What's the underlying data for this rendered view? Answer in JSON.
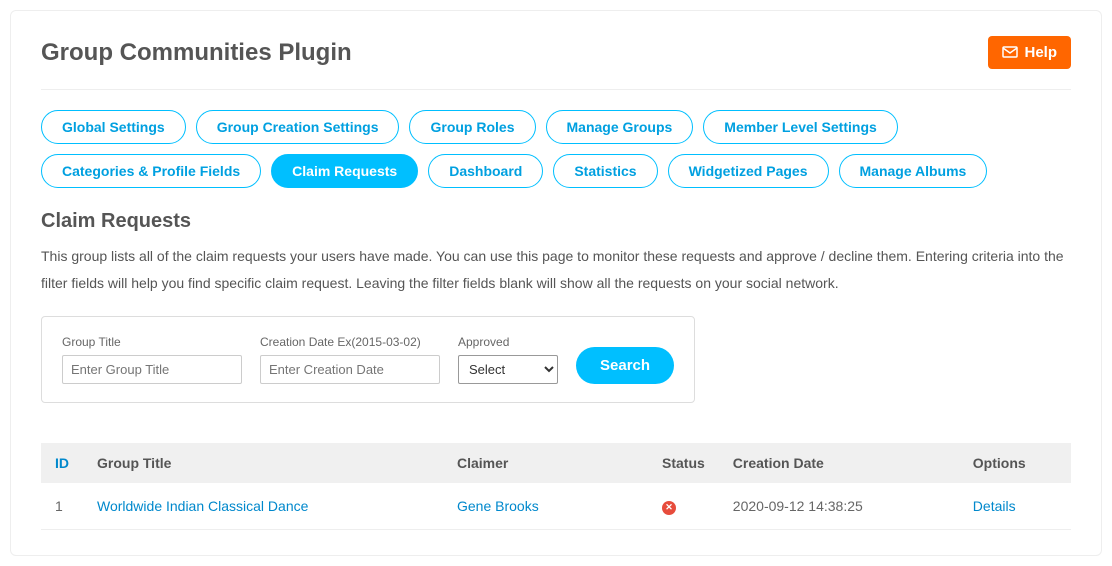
{
  "header": {
    "title": "Group Communities Plugin",
    "help_label": "Help"
  },
  "tabs": [
    {
      "label": "Global Settings",
      "active": false
    },
    {
      "label": "Group Creation Settings",
      "active": false
    },
    {
      "label": "Group Roles",
      "active": false
    },
    {
      "label": "Manage Groups",
      "active": false
    },
    {
      "label": "Member Level Settings",
      "active": false
    },
    {
      "label": "Categories & Profile Fields",
      "active": false
    },
    {
      "label": "Claim Requests",
      "active": true
    },
    {
      "label": "Dashboard",
      "active": false
    },
    {
      "label": "Statistics",
      "active": false
    },
    {
      "label": "Widgetized Pages",
      "active": false
    },
    {
      "label": "Manage Albums",
      "active": false
    }
  ],
  "section": {
    "title": "Claim Requests",
    "description": "This group lists all of the claim requests your users have made. You can use this page to monitor these requests and approve / decline them. Entering criteria into the filter fields will help you find specific claim request. Leaving the filter fields blank will show all the requests on your social network."
  },
  "filters": {
    "group_title_label": "Group Title",
    "group_title_placeholder": "Enter Group Title",
    "creation_date_label": "Creation Date Ex(2015-03-02)",
    "creation_date_placeholder": "Enter Creation Date",
    "approved_label": "Approved",
    "approved_selected": "Select",
    "search_label": "Search"
  },
  "table": {
    "headers": {
      "id": "ID",
      "group_title": "Group Title",
      "claimer": "Claimer",
      "status": "Status",
      "creation_date": "Creation Date",
      "options": "Options"
    },
    "rows": [
      {
        "id": "1",
        "group_title": "Worldwide Indian Classical Dance",
        "claimer": "Gene Brooks",
        "status": "rejected",
        "creation_date": "2020-09-12 14:38:25",
        "options": "Details"
      }
    ]
  }
}
